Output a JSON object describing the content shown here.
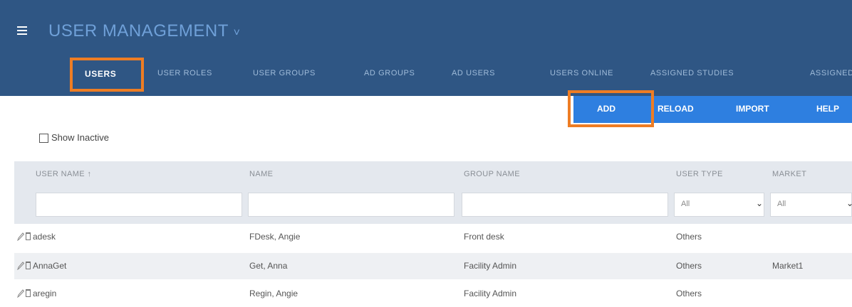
{
  "header": {
    "title": "USER MANAGEMENT",
    "title_caret": "˅",
    "tabs": [
      {
        "label": "USERS",
        "active": true
      },
      {
        "label": "USER ROLES"
      },
      {
        "label": "USER GROUPS"
      },
      {
        "label": "AD GROUPS"
      },
      {
        "label": "AD USERS"
      },
      {
        "label": "USERS ONLINE"
      },
      {
        "label": "ASSIGNED STUDIES"
      },
      {
        "label": "ASSIGNED"
      }
    ]
  },
  "toolbar": {
    "add_label": "ADD",
    "reload_label": "RELOAD",
    "import_label": "IMPORT",
    "help_label": "HELP"
  },
  "filters": {
    "show_inactive_label": "Show Inactive",
    "user_type_selected": "All",
    "market_selected": "All"
  },
  "table": {
    "columns": [
      "USER NAME ↑",
      "NAME",
      "GROUP NAME",
      "USER TYPE",
      "MARKET"
    ],
    "rows": [
      {
        "username": "adesk",
        "name": "FDesk, Angie",
        "group": "Front desk",
        "user_type": "Others",
        "market": ""
      },
      {
        "username": "AnnaGet",
        "name": "Get, Anna",
        "group": "Facility Admin",
        "user_type": "Others",
        "market": "Market1"
      },
      {
        "username": "aregin",
        "name": "Regin, Angie",
        "group": "Facility Admin",
        "user_type": "Others",
        "market": ""
      }
    ]
  },
  "colors": {
    "header_bg": "#2f5684",
    "toolbar_bg": "#2e7fe0",
    "highlight": "#ee7d24"
  }
}
